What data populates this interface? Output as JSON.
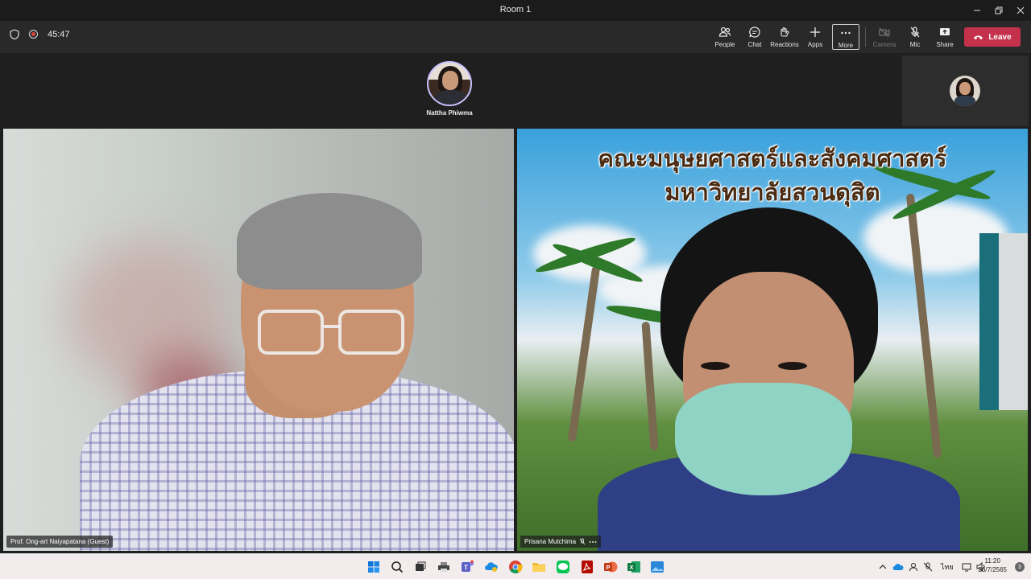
{
  "window": {
    "title": "Room 1"
  },
  "toolbar": {
    "timer": "45:47",
    "buttons": {
      "people": "People",
      "chat": "Chat",
      "reactions": "Reactions",
      "apps": "Apps",
      "more": "More",
      "camera": "Camera",
      "mic": "Mic",
      "share": "Share"
    },
    "leave_label": "Leave",
    "leave_color": "#c4314b"
  },
  "participants": {
    "top": {
      "name": "Nattha Phiwma"
    },
    "left_video": {
      "name": "Prof. Ong-art Naiyapatana (Guest)"
    },
    "right_video": {
      "name": "Prisana Mutchima",
      "banner_line1": "คณะมนุษยศาสตร์และสังคมศาสตร์",
      "banner_line2": "มหาวิทยาลัยสวนดุสิต"
    }
  },
  "taskbar": {
    "icons": [
      "windows-start-icon",
      "search-icon",
      "task-view-icon",
      "printer-icon",
      "teams-icon",
      "onedrive-icon",
      "chrome-icon",
      "file-explorer-icon",
      "line-icon",
      "acrobat-icon",
      "powerpoint-icon",
      "excel-icon",
      "photos-icon"
    ],
    "tray": {
      "language": "ไทย",
      "time": "11:20",
      "date": "26/7/2565",
      "notifications": "3"
    }
  }
}
